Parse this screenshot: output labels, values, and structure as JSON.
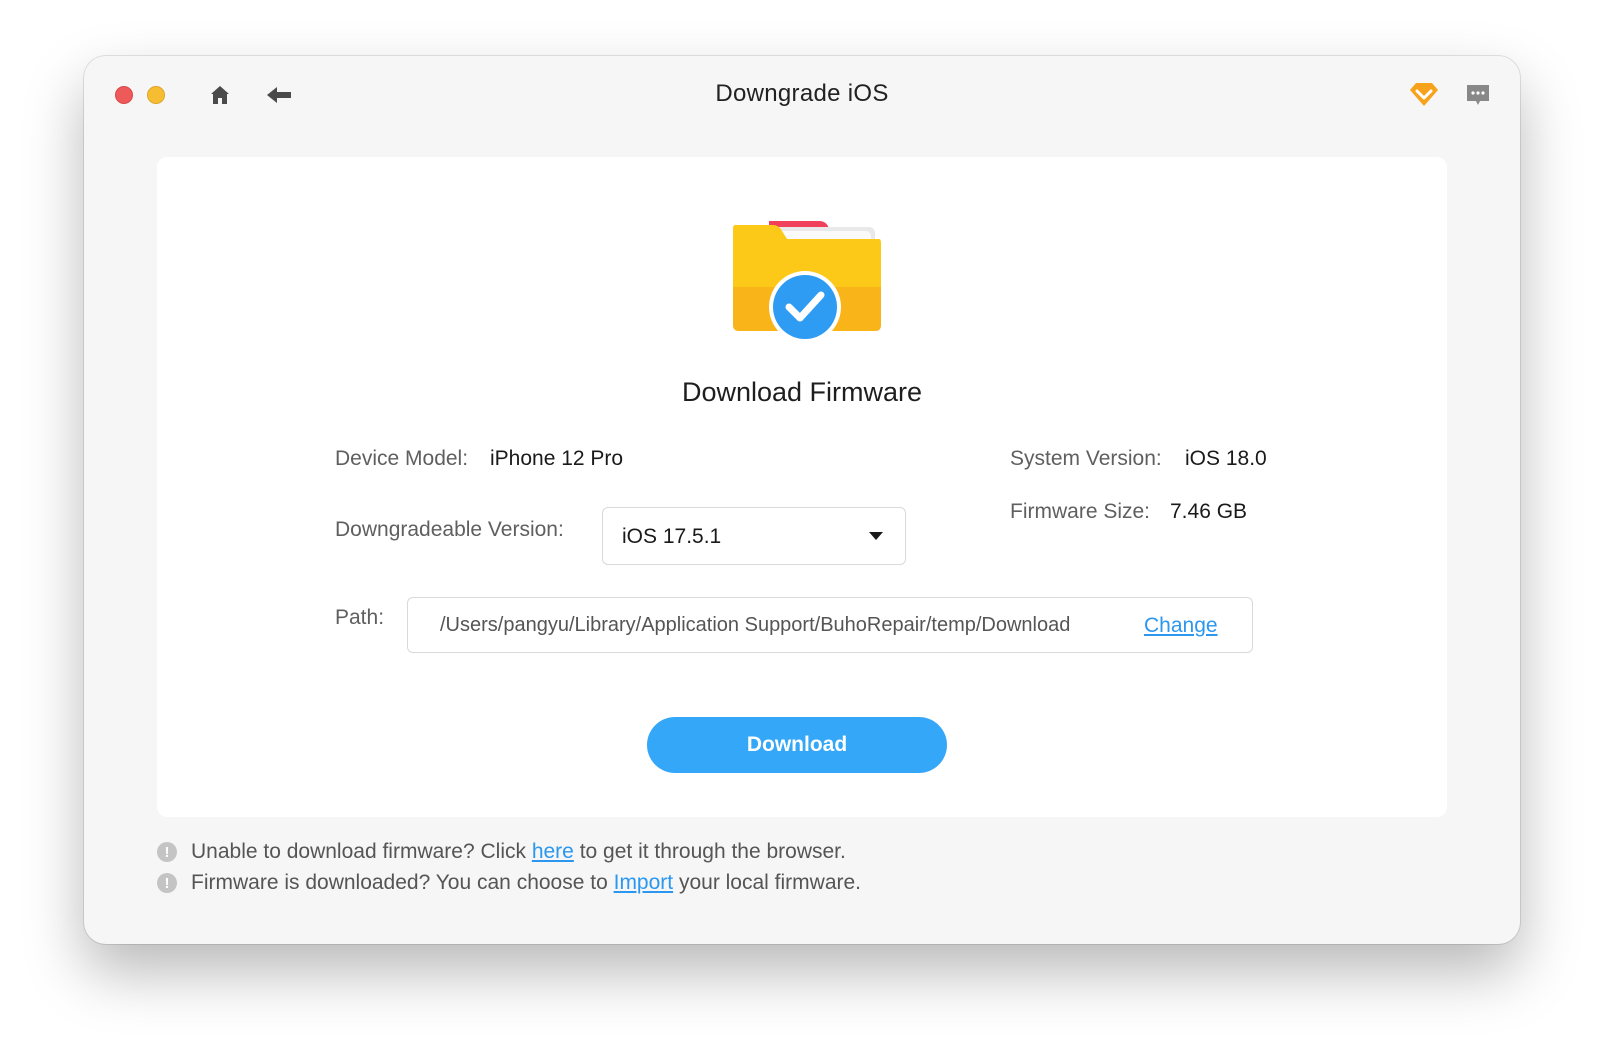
{
  "window": {
    "title": "Downgrade iOS",
    "controls": [
      "close",
      "minimize"
    ],
    "icons": {
      "home": "home-icon",
      "back": "back-arrow-icon",
      "vip": "diamond-icon",
      "feedback": "chat-icon"
    }
  },
  "card": {
    "icon": "folder-check-icon",
    "title": "Download Firmware",
    "device_model_label": "Device Model:",
    "device_model_value": "iPhone 12 Pro",
    "system_version_label": "System Version:",
    "system_version_value": "iOS 18.0",
    "downgradeable_label": "Downgradeable Version:",
    "downgradeable_value": "iOS 17.5.1",
    "firmware_size_label": "Firmware Size:",
    "firmware_size_value": "7.46 GB",
    "path_label": "Path:",
    "path_value": "/Users/pangyu/Library/Application Support/BuhoRepair/temp/Download",
    "change_label": "Change",
    "download_label": "Download"
  },
  "notes": {
    "line1_pre": "Unable to download firmware? Click ",
    "line1_link": "here",
    "line1_post": " to get it through the browser.",
    "line2_pre": "Firmware is downloaded? You can choose to ",
    "line2_link": "Import",
    "line2_post": " your local firmware."
  },
  "colors": {
    "accent": "#35a7f8",
    "link": "#2b97ef",
    "close": "#ee5a5a",
    "minimize": "#f6bd33",
    "vip": "#f7a21b"
  }
}
